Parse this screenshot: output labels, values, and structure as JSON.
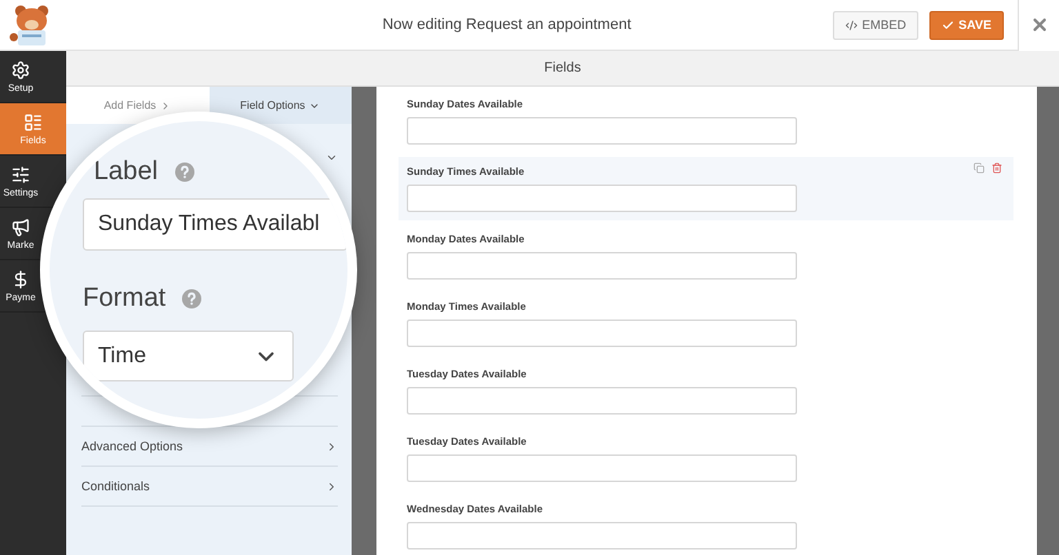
{
  "header": {
    "title": "Now editing Request an appointment",
    "buttons": [
      {
        "label": "EMBED",
        "kind": "embed"
      },
      {
        "label": "SAVE",
        "kind": "save"
      }
    ]
  },
  "sidebar": {
    "items": [
      {
        "label": "Setup",
        "selected": false
      },
      {
        "label": "Fields",
        "selected": true
      },
      {
        "label": "Settings",
        "selected": false
      },
      {
        "label": "Marke",
        "selected": false
      },
      {
        "label": "Payme",
        "selected": false
      }
    ]
  },
  "subheader": {
    "title": "Fields"
  },
  "panel": {
    "tabs": [
      {
        "label": "Add Fields",
        "selected": false
      },
      {
        "label": "Field Options",
        "selected": true
      }
    ],
    "general_expanded": true,
    "sections": [
      {
        "label": "Advanced Options",
        "expanded": false
      },
      {
        "label": "Conditionals",
        "expanded": false
      }
    ]
  },
  "magnifier": {
    "label_title": "Label",
    "label_value": "Sunday Times Availabl",
    "format_title": "Format",
    "format_value": "Time"
  },
  "form": {
    "fields": [
      {
        "label": "Sunday Dates Available",
        "selected": false
      },
      {
        "label": "Sunday Times Available",
        "selected": true
      },
      {
        "label": "Monday Dates Available",
        "selected": false
      },
      {
        "label": "Monday Times Available",
        "selected": false
      },
      {
        "label": "Tuesday Dates Available",
        "selected": false
      },
      {
        "label": "Tuesday Dates Available",
        "selected": false
      },
      {
        "label": "Wednesday Dates Available",
        "selected": false
      }
    ]
  }
}
